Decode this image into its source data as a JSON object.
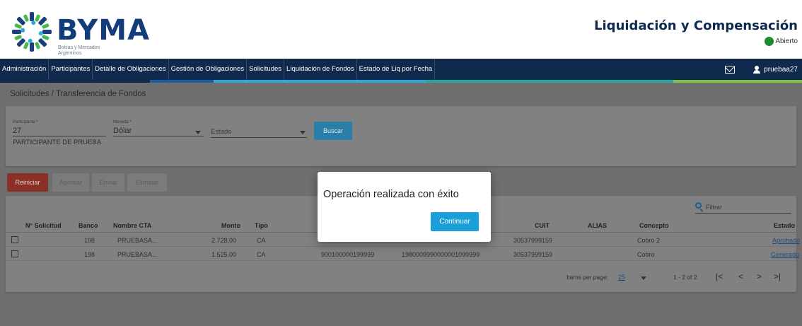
{
  "brand": {
    "name": "BYMA",
    "tagline_line1": "Bolsas y Mercados",
    "tagline_line2": "Argentinos"
  },
  "app": {
    "title": "Liquidación y Compensación",
    "status": "Abierto",
    "status_color": "#1a8c2e"
  },
  "nav": {
    "items": [
      "Administración",
      "Participantes",
      "Detalle de Obligaciones",
      "Gestión de Obligaciones",
      "Solicitudes",
      "Liquidación de Fondos",
      "Estado de Liq por Fecha"
    ],
    "icons": [
      "mail-icon",
      "user-icon"
    ],
    "user": "pruebaa27"
  },
  "breadcrumb": "Solicitudes / Transferencia de Fondos",
  "form": {
    "participante_label": "Participante *",
    "participante_value": "27",
    "participante_name": "PARTICIPANTE DE PRUEBA",
    "moneda_label": "Moneda *",
    "moneda_value": "Dólar",
    "estado_placeholder": "Estado",
    "search_button": "Buscar"
  },
  "actions": {
    "reset": "Reiniciar",
    "approve": "Aprobar",
    "send": "Enviar",
    "delete": "Eliminar"
  },
  "filter_placeholder": "Filtrar",
  "table": {
    "columns": [
      "N° Solicitud",
      "Banco",
      "Nombre CTA",
      "Monto",
      "Tipo",
      "CUIT",
      "ALIAS",
      "Concepto",
      "Estado"
    ],
    "rows": [
      {
        "solicitud": "",
        "banco": "198",
        "nombre": "PRUEBASA...",
        "monto": "2.728,00",
        "tipo": "CA",
        "cuenta": "",
        "cbu": "",
        "cuit": "30537999159",
        "alias": "",
        "concepto": "Cobro 2",
        "estado": "Aprobado"
      },
      {
        "solicitud": "",
        "banco": "198",
        "nombre": "PRUEBASA...",
        "monto": "1.525,00",
        "tipo": "CA",
        "cuenta": "900100000199999",
        "cbu": "1980009990000001099999",
        "cuit": "30537999159",
        "alias": "",
        "concepto": "Cobro",
        "estado": "Generado"
      }
    ]
  },
  "paginator": {
    "label": "Items per page:",
    "page_size": "25",
    "range": "1 - 2 of 2",
    "first": "|<",
    "prev": "<",
    "next": ">",
    "last": ">|"
  },
  "dialog": {
    "message": "Operación realizada con éxito",
    "button": "Continuar"
  },
  "colors": {
    "brand_navy": "#0f2a4d",
    "dialog_button": "#1b9fd8",
    "reset_button": "#d8473a",
    "search_button": "#1b9fd8"
  }
}
